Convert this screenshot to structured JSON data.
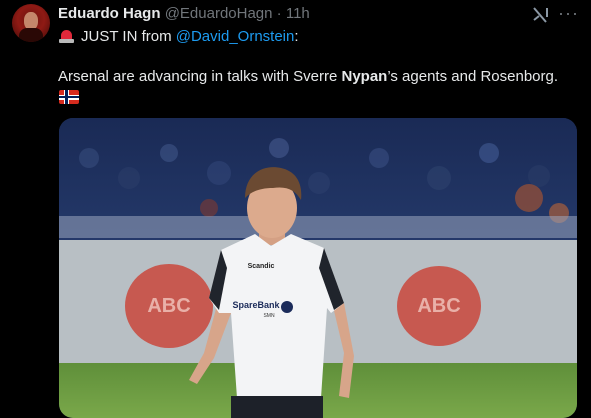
{
  "author": {
    "name": "Eduardo Hagn",
    "handle": "@EduardoHagn",
    "separator": "·",
    "time": "11h"
  },
  "tweet": {
    "prefix": "JUST IN from",
    "mention": "@David_Ornstein",
    "suffix": ":",
    "body_before": "Arsenal are advancing in talks with Sverre ",
    "body_bold": "Nypan",
    "body_after": "’s agents and Rosenborg.",
    "flag_icon": "norway-flag-icon"
  },
  "icons": {
    "siren": "police-light-icon",
    "grok": "grok-icon",
    "more": "more-icon"
  },
  "colors": {
    "background": "#000000",
    "text": "#e7e9ea",
    "muted": "#71767b",
    "link": "#1d9bf0"
  },
  "media": {
    "kit_sponsor": "Scandic",
    "shirt_sponsor": "SpareBank",
    "shirt_sponsor_sub": "SMN",
    "board_text_left": "ABC",
    "board_text_right": "ABC"
  }
}
